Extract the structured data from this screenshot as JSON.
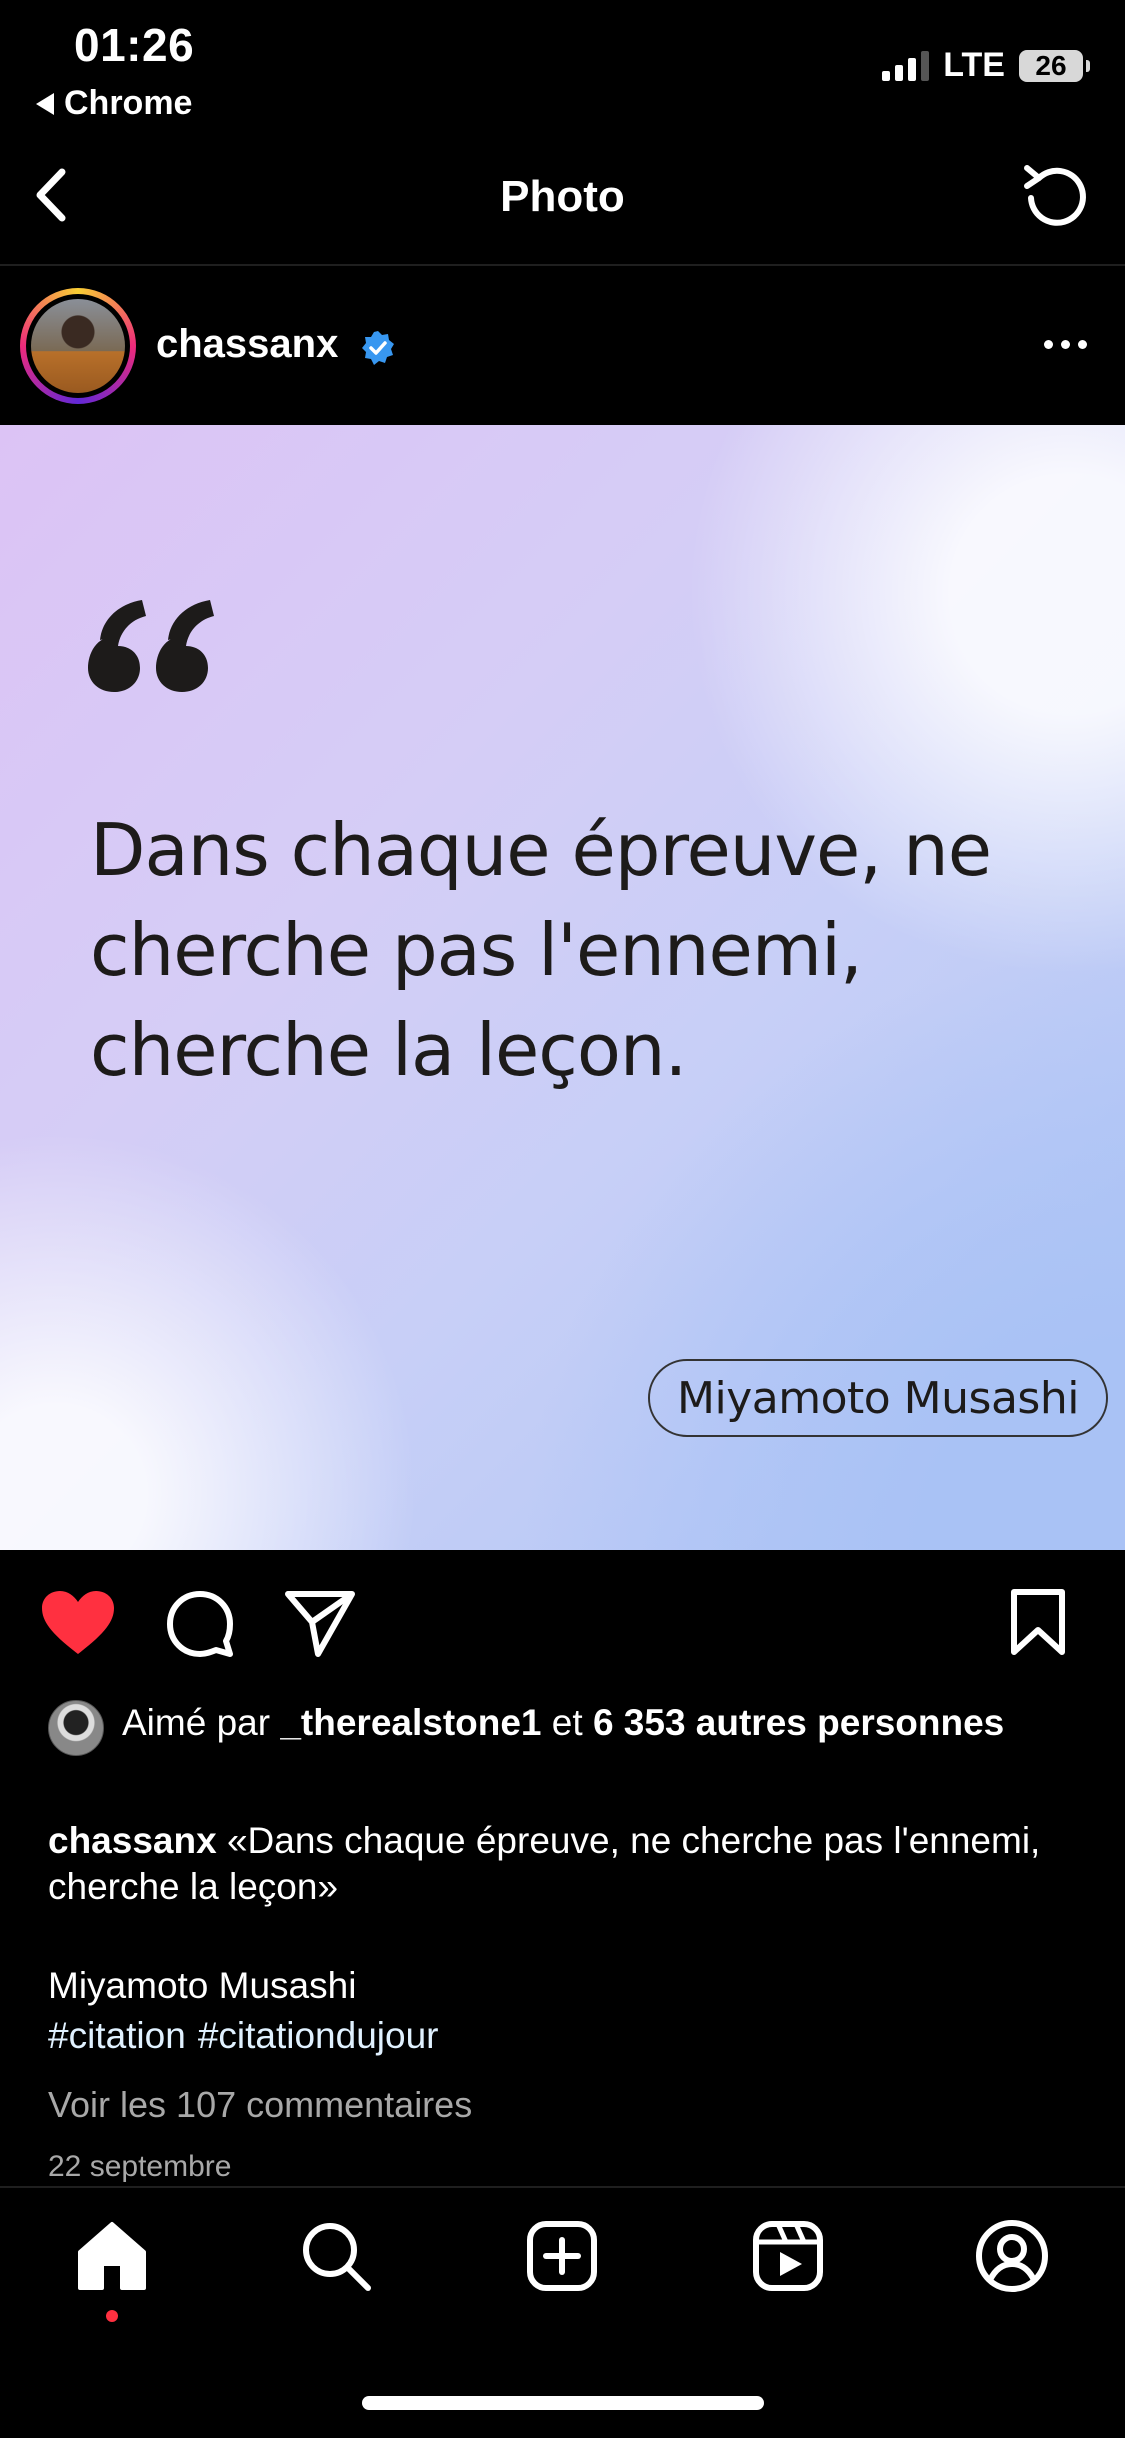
{
  "status_bar": {
    "time": "01:26",
    "back_app": "Chrome",
    "network": "LTE",
    "battery": "26"
  },
  "nav": {
    "title": "Photo"
  },
  "post": {
    "username": "chassanx",
    "verified": true,
    "image": {
      "quote_mark": "“",
      "quote": "Dans chaque épreuve, ne cherche pas l'ennemi, cherche la leçon.",
      "author": "Miyamoto Musashi"
    },
    "likes": {
      "prefix": "Aimé par",
      "liker": "_therealstone1",
      "connector": "et",
      "others": "6 353 autres personnes"
    },
    "caption": {
      "username": "chassanx",
      "text": "«Dans chaque épreuve, ne cherche pas l'ennemi, cherche la leçon»",
      "author_line": "Miyamoto Musashi",
      "hashtags": [
        "#citation",
        "#citationdujour"
      ]
    },
    "view_comments": "Voir les 107 commentaires",
    "date": "22 septembre"
  },
  "colors": {
    "like_red": "#ff3040",
    "verified_blue": "#3897f0",
    "muted_text": "#a8a8a8",
    "hashtag": "#e0f1ff"
  },
  "icons": {
    "back": "chevron-left-icon",
    "refresh": "refresh-icon",
    "more": "more-horizontal-icon",
    "like": "heart-filled-icon",
    "comment": "comment-icon",
    "share": "send-icon",
    "save": "bookmark-icon",
    "tabs": [
      "home-icon",
      "search-icon",
      "create-icon",
      "reels-icon",
      "profile-icon"
    ]
  }
}
